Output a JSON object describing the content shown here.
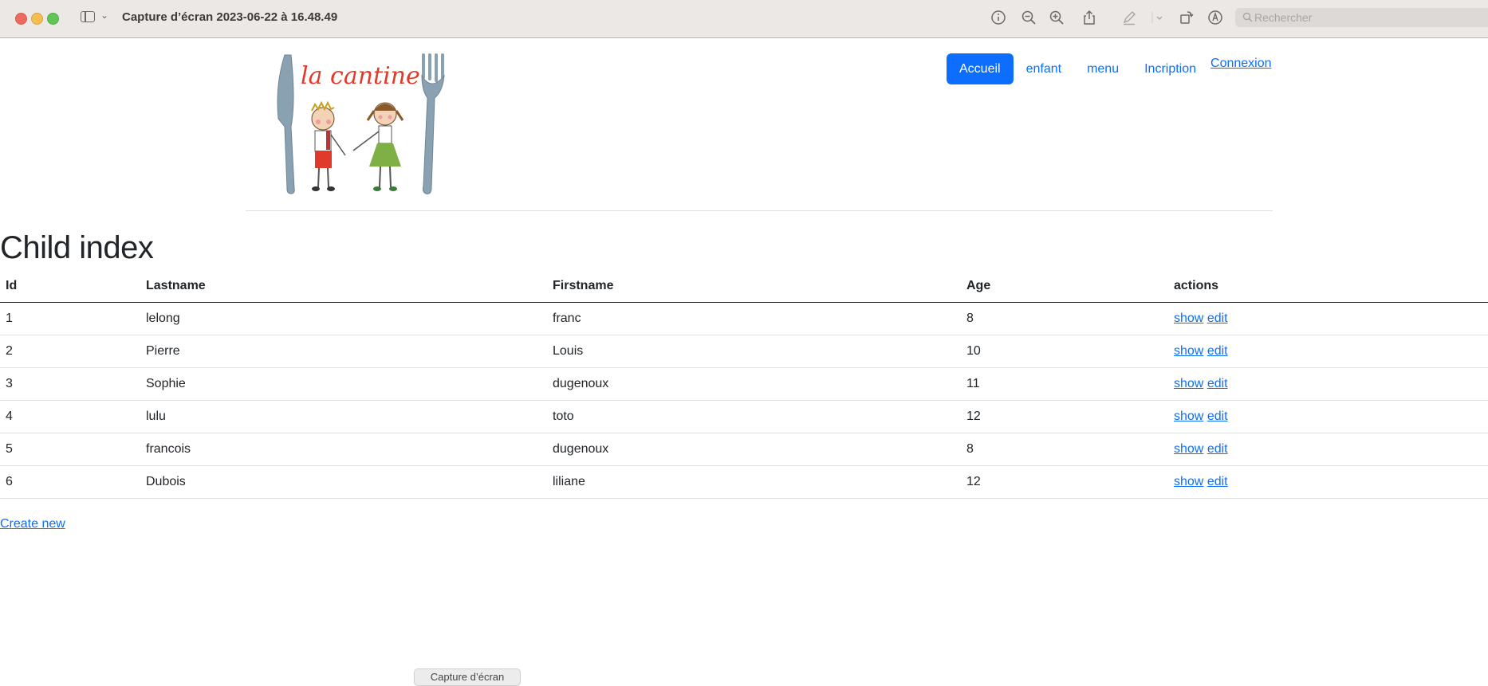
{
  "window": {
    "title": "Capture d’écran 2023-06-22 à 16.48.49",
    "search_placeholder": "Rechercher",
    "toolbar_icons": [
      "info-icon",
      "zoom-out-icon",
      "zoom-in-icon",
      "share-icon",
      "markup-pen-icon",
      "chevron-down-icon",
      "rotate-icon",
      "markup-icon"
    ]
  },
  "header": {
    "logo_text": "la cantine",
    "nav": [
      {
        "label": "Accueil",
        "active": true
      },
      {
        "label": "enfant"
      },
      {
        "label": "menu"
      },
      {
        "label": "Incription"
      }
    ],
    "login_label": "Connexion"
  },
  "main": {
    "title": "Child index",
    "table": {
      "columns": [
        "Id",
        "Lastname",
        "Firstname",
        "Age",
        "actions"
      ],
      "rows": [
        {
          "id": "1",
          "lastname": "lelong",
          "firstname": "franc",
          "age": "8"
        },
        {
          "id": "2",
          "lastname": "Pierre",
          "firstname": "Louis",
          "age": "10"
        },
        {
          "id": "3",
          "lastname": "Sophie",
          "firstname": "dugenoux",
          "age": "11"
        },
        {
          "id": "4",
          "lastname": "lulu",
          "firstname": "toto",
          "age": "12"
        },
        {
          "id": "5",
          "lastname": "francois",
          "firstname": "dugenoux",
          "age": "8"
        },
        {
          "id": "6",
          "lastname": "Dubois",
          "firstname": "liliane",
          "age": "12"
        }
      ],
      "show_label": "show",
      "edit_label": "edit"
    },
    "create_label": "Create new"
  },
  "footer": {
    "pill_label": "Capture d’écran"
  },
  "colors": {
    "link": "#0d6efd",
    "title_bar": "#ebe8e6",
    "logo_red": "#e03a2a"
  }
}
